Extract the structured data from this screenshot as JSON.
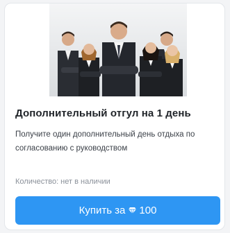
{
  "card": {
    "image_icon": "team-photo",
    "title": "Дополнительный отгул на 1 день",
    "description": "Получите один дополнительный день отдыха по согласованию с руководством",
    "quantity": "Количество: нет в наличии",
    "buy_label": "Купить за",
    "currency_icon": "gem-icon",
    "price": "100"
  },
  "colors": {
    "accent": "#2e96f3",
    "title": "#1f2328",
    "muted": "#8a9099"
  }
}
